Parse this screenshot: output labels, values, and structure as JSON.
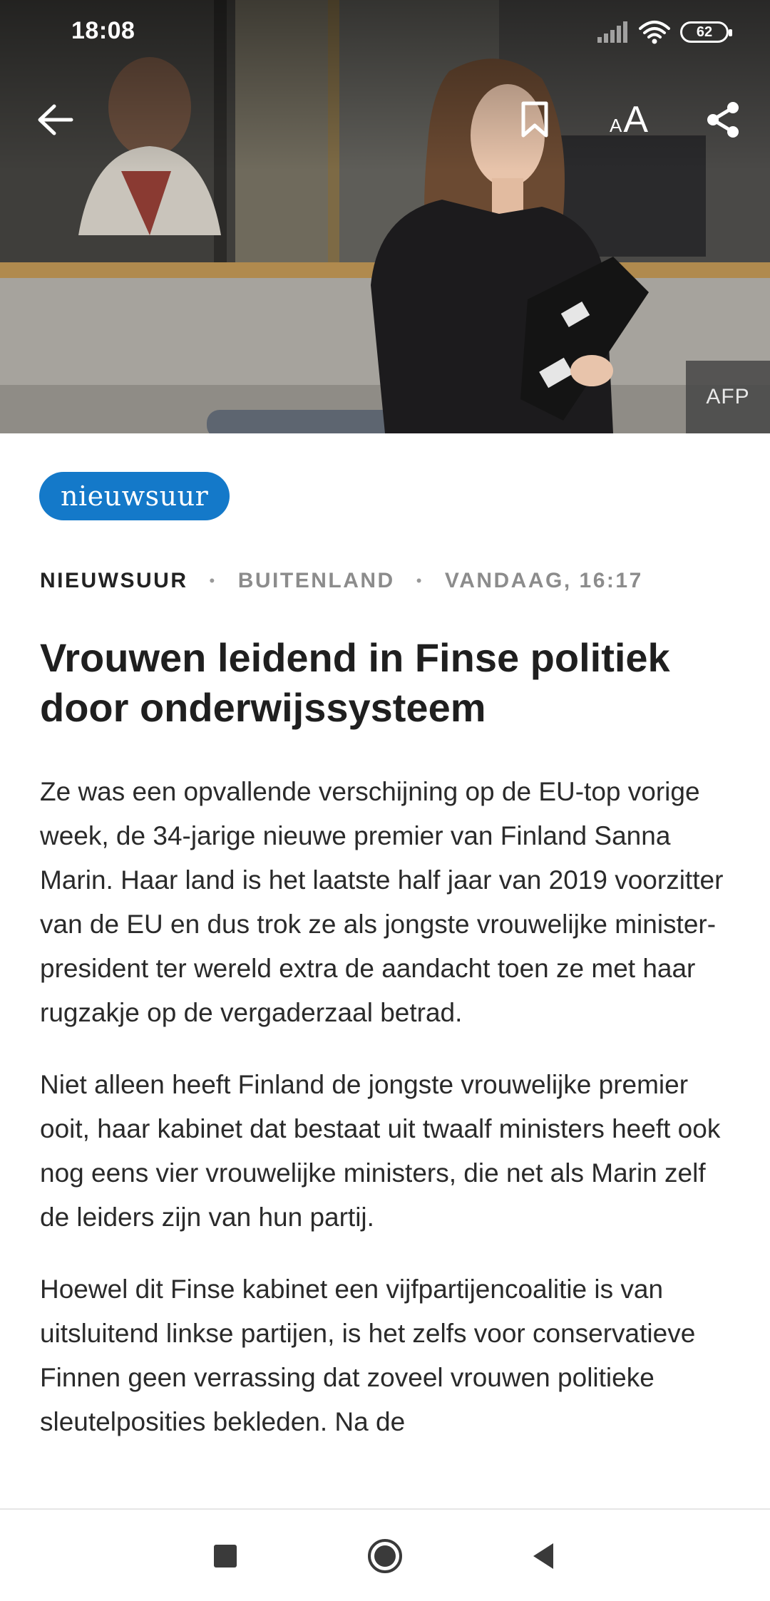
{
  "status_bar": {
    "time": "18:08",
    "battery": "62"
  },
  "toolbar": {
    "font_small": "A",
    "font_large": "A"
  },
  "hero": {
    "photo_credit": "AFP"
  },
  "article": {
    "brand_pill": "nieuwsuur",
    "source": "NIEUWSUUR",
    "separator": "•",
    "category": "BUITENLAND",
    "date": "VANDAAG, 16:17",
    "title": "Vrouwen leidend in Finse politiek door onderwijssysteem",
    "paragraphs": [
      "Ze was een opvallende verschijning op de EU-top vorige week, de 34-jarige nieuwe premier van Finland Sanna Marin. Haar land is het laatste half jaar van 2019 voorzitter van de EU en dus trok ze als jongste vrouwelijke minister-president ter wereld extra de aandacht toen ze met haar rugzakje op de vergaderzaal betrad.",
      "Niet alleen heeft Finland de jongste vrouwelijke premier ooit, haar kabinet dat bestaat uit twaalf ministers heeft ook nog eens vier vrouwelijke ministers, die net als Marin zelf de leiders zijn van hun partij.",
      "Hoewel dit Finse kabinet een vijfpartijencoalitie is van uitsluitend linkse partijen, is het zelfs voor conservatieve Finnen geen verrassing dat zoveel vrouwen politieke sleutelposities bekleden. Na de"
    ]
  },
  "colors": {
    "brand_blue": "#1479c9",
    "title_text": "#1f1f1f",
    "meta_grey": "#8c8c8c"
  },
  "icons": [
    "back-arrow-icon",
    "bookmark-icon",
    "font-size-icon",
    "share-icon",
    "signal-icon",
    "wifi-icon",
    "battery-icon",
    "recent-apps-icon",
    "home-icon",
    "nav-back-icon"
  ]
}
